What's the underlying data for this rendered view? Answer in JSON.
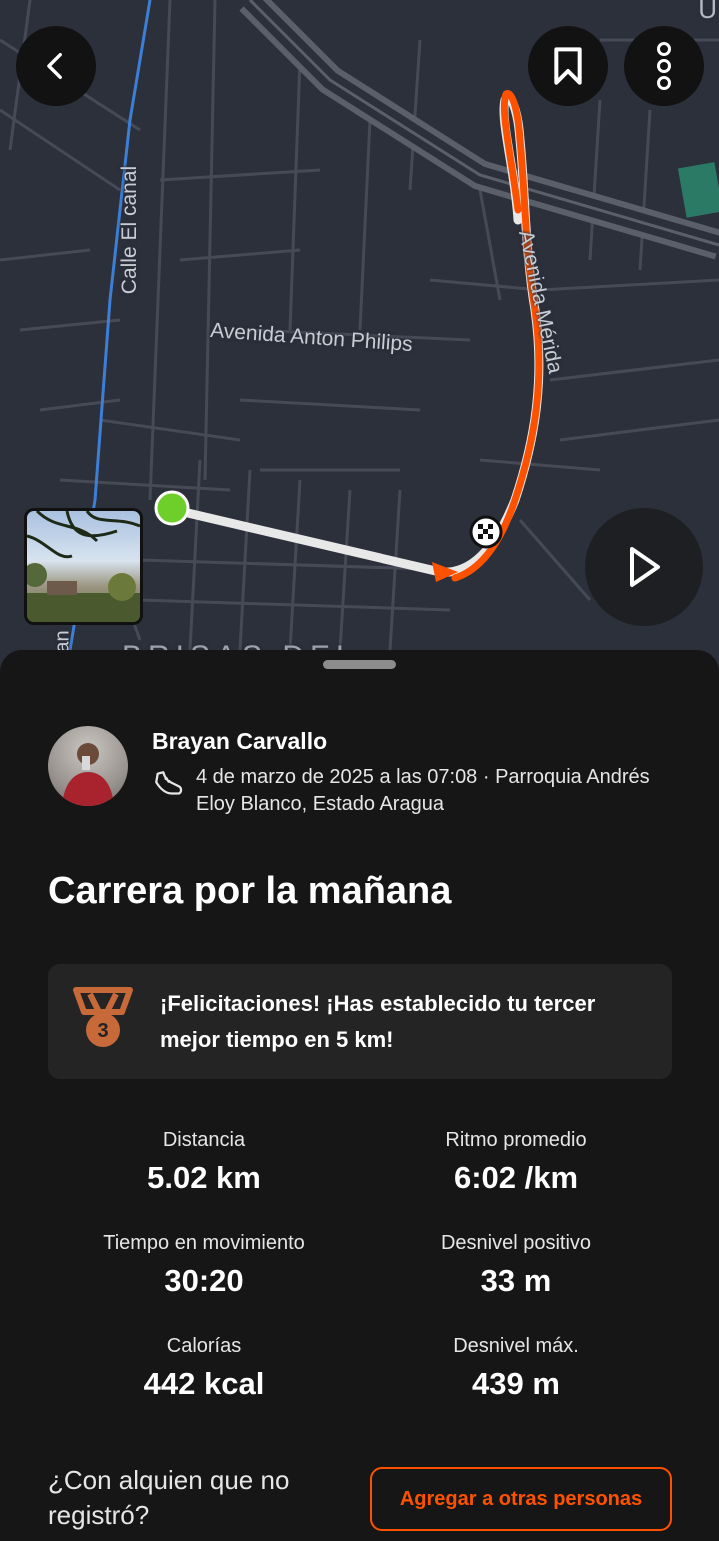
{
  "map": {
    "labels": {
      "calle_el_canal": "Calle El canal",
      "avenida_anton_philips": "Avenida Anton Philips",
      "avenida_merida": "Avenida Mérida",
      "brisas": "BRISAS DEL",
      "an": "an",
      "u": "U"
    },
    "route_color": "#fc5200",
    "start_color": "#6fcf2a"
  },
  "toolbar": {
    "back_icon": "chevron-left-icon",
    "bookmark_icon": "bookmark-icon",
    "more_icon": "more-vertical-icon",
    "play_icon": "play-icon"
  },
  "athlete": {
    "name": "Brayan Carvallo",
    "activity_icon": "running-shoe-icon",
    "meta": "4 de marzo de 2025 a las 07:08 · Parroquia Andrés Eloy Blanco, Estado Aragua"
  },
  "activity": {
    "title": "Carrera por la mañana"
  },
  "achievement": {
    "icon": "bronze-medal-icon",
    "medal_number": "3",
    "text": "¡Felicitaciones! ¡Has establecido tu tercer mejor tiempo en 5 km!"
  },
  "stats": {
    "distance": {
      "label": "Distancia",
      "value": "5.02 km"
    },
    "pace": {
      "label": "Ritmo promedio",
      "value": "6:02 /km"
    },
    "moving_time": {
      "label": "Tiempo en movimiento",
      "value": "30:20"
    },
    "elevation_gain": {
      "label": "Desnivel positivo",
      "value": "33 m"
    },
    "calories": {
      "label": "Calorías",
      "value": "442 kcal"
    },
    "max_elevation": {
      "label": "Desnivel máx.",
      "value": "439 m"
    }
  },
  "invite": {
    "question": "¿Con alquien que no registró?",
    "button_label": "Agregar a otras personas"
  },
  "colors": {
    "accent": "#fc5200",
    "medal": "#c8693a"
  }
}
